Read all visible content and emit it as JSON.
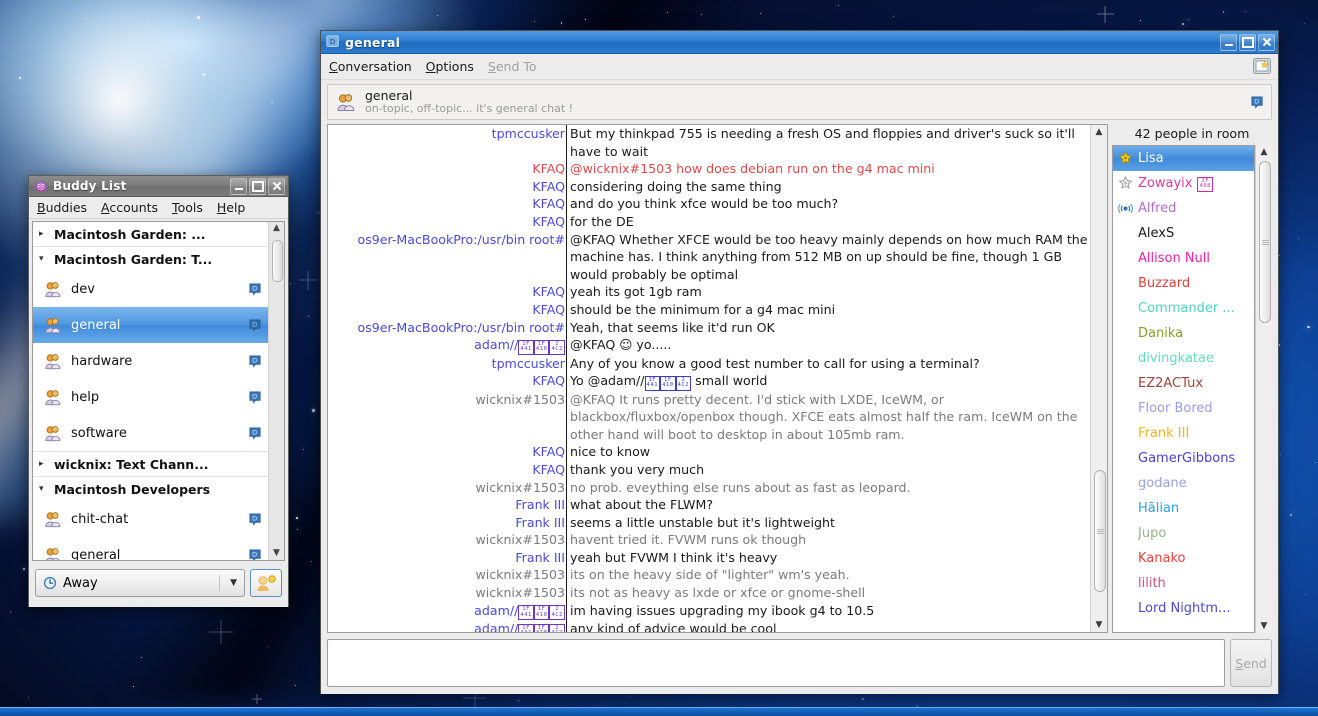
{
  "desktop": {
    "wallpaper": "space-nebula-blue"
  },
  "buddy_window": {
    "title": "Buddy List",
    "icon": "pidgin-buddy-icon",
    "menus": [
      {
        "label": "Buddies",
        "accel": "B"
      },
      {
        "label": "Accounts",
        "accel": "A"
      },
      {
        "label": "Tools",
        "accel": "T"
      },
      {
        "label": "Help",
        "accel": "H"
      }
    ],
    "window_buttons": [
      "minimize",
      "maximize",
      "close"
    ],
    "rows": [
      {
        "type": "group",
        "label": "Macintosh Garden: ...",
        "expanded": false
      },
      {
        "type": "group",
        "label": "Macintosh Garden: T...",
        "expanded": true
      },
      {
        "type": "chat",
        "label": "dev",
        "protocol_badge": "D",
        "selected": false
      },
      {
        "type": "chat",
        "label": "general",
        "protocol_badge": "D",
        "selected": true
      },
      {
        "type": "chat",
        "label": "hardware",
        "protocol_badge": "D",
        "selected": false
      },
      {
        "type": "chat",
        "label": "help",
        "protocol_badge": "D",
        "selected": false
      },
      {
        "type": "chat",
        "label": "software",
        "protocol_badge": "D",
        "selected": false
      },
      {
        "type": "group",
        "label": "wicknix: Text Chann...",
        "expanded": false
      },
      {
        "type": "group",
        "label": "Macintosh Developers",
        "expanded": true
      },
      {
        "type": "chat",
        "label": "chit-chat",
        "protocol_badge": "D",
        "selected": false
      },
      {
        "type": "chat",
        "label": "general",
        "protocol_badge": "D",
        "selected": false
      }
    ],
    "status": {
      "label": "Away",
      "icon": "away-clock-icon",
      "dropdown": "chevron-down-icon"
    },
    "account_button": "accounts-icon"
  },
  "conversation_window": {
    "title": "general",
    "icon": "protocol-d-icon",
    "window_buttons": [
      "minimize",
      "maximize",
      "close"
    ],
    "menus": [
      {
        "label": "Conversation",
        "accel": "C",
        "disabled": false
      },
      {
        "label": "Options",
        "accel": "O",
        "disabled": false
      },
      {
        "label": "Send To",
        "accel": "S",
        "disabled": true
      }
    ],
    "menu_right_icon": "conversation-notify-icon",
    "topic": {
      "icon": "chat-group-icon",
      "name": "general",
      "text": "on-topic, off-topic... it's general chat !",
      "badge": "D"
    },
    "user_count_label": "42 people in room",
    "entry": {
      "value": "",
      "placeholder": ""
    },
    "send_button": {
      "label": "Send",
      "accel": "S",
      "enabled": false
    },
    "messages": [
      {
        "who": "tpmccusker",
        "who_color": "#4a4ad6",
        "text": "But my thinkpad 755 is needing a fresh OS and floppies and driver's suck so it'll have to wait",
        "color": "#1a1a1a"
      },
      {
        "who": "KFAQ",
        "who_color": "#e04a4a",
        "text": "@wicknix#1503 how does debian run on the g4 mac mini",
        "color": "#e04a4a"
      },
      {
        "who": "KFAQ",
        "who_color": "#4a4ad6",
        "text": "considering doing the same thing",
        "color": "#1a1a1a"
      },
      {
        "who": "KFAQ",
        "who_color": "#4a4ad6",
        "text": "and do you think xfce would be too much?",
        "color": "#1a1a1a"
      },
      {
        "who": "KFAQ",
        "who_color": "#4a4ad6",
        "text": "for the DE",
        "color": "#1a1a1a"
      },
      {
        "who": "os9er-MacBookPro:/usr/bin root#",
        "who_color": "#4a4ad6",
        "text": "@KFAQ Whether XFCE would be too heavy mainly depends on how much RAM the machine has. I think anything from 512 MB on up should be fine, though 1 GB would probably be optimal",
        "color": "#1a1a1a"
      },
      {
        "who": "KFAQ",
        "who_color": "#4a4ad6",
        "text": "yeah its got 1gb ram",
        "color": "#1a1a1a"
      },
      {
        "who": "KFAQ",
        "who_color": "#4a4ad6",
        "text": "should be the minimum for a g4 mac mini",
        "color": "#1a1a1a"
      },
      {
        "who": "os9er-MacBookPro:/usr/bin root#",
        "who_color": "#4a4ad6",
        "text": "Yeah, that seems like it'd run OK",
        "color": "#1a1a1a"
      },
      {
        "who": "adam//",
        "who_color": "#4a4ad6",
        "who_tofu": [
          "1F441",
          "1F410",
          "24C2"
        ],
        "text": "@KFAQ ☺ yo.....",
        "color": "#1a1a1a"
      },
      {
        "who": "tpmccusker",
        "who_color": "#4a4ad6",
        "text": "Any of you know a good test number to call for using a terminal?",
        "color": "#1a1a1a"
      },
      {
        "who": "KFAQ",
        "who_color": "#4a4ad6",
        "text": "Yo @adam//",
        "text_tofu": [
          "1F441",
          "1F410",
          "24C2"
        ],
        "text_after": " small world",
        "color": "#1a1a1a"
      },
      {
        "who": "wicknix#1503",
        "who_color": "#7a7a7a",
        "text": "@KFAQ It runs pretty decent. I'd stick with LXDE, IceWM, or blackbox/fluxbox/openbox though. XFCE eats almost half the ram. IceWM on the other hand will boot to desktop in about 105mb ram.",
        "color": "#7a7a7a"
      },
      {
        "who": "KFAQ",
        "who_color": "#4a4ad6",
        "text": "nice to know",
        "color": "#1a1a1a"
      },
      {
        "who": "KFAQ",
        "who_color": "#4a4ad6",
        "text": "thank you very much",
        "color": "#1a1a1a"
      },
      {
        "who": "wicknix#1503",
        "who_color": "#7a7a7a",
        "text": "no prob. eveything else runs about as fast as leopard.",
        "color": "#7a7a7a"
      },
      {
        "who": "Frank III",
        "who_color": "#4a4ad6",
        "text": "what about the FLWM?",
        "color": "#1a1a1a"
      },
      {
        "who": "Frank III",
        "who_color": "#4a4ad6",
        "text": "seems a little unstable but it's lightweight",
        "color": "#1a1a1a"
      },
      {
        "who": "wicknix#1503",
        "who_color": "#7a7a7a",
        "text": "havent tried it. FVWM runs ok though",
        "color": "#7a7a7a"
      },
      {
        "who": "Frank III",
        "who_color": "#4a4ad6",
        "text": "yeah but FVWM I think it's heavy",
        "color": "#1a1a1a"
      },
      {
        "who": "wicknix#1503",
        "who_color": "#7a7a7a",
        "text": "its on the heavy side of \"lighter\" wm's yeah.",
        "color": "#7a7a7a"
      },
      {
        "who": "wicknix#1503",
        "who_color": "#7a7a7a",
        "text": "its not as heavy as lxde or xfce or gnome-shell",
        "color": "#7a7a7a"
      },
      {
        "who": "adam//",
        "who_color": "#4a4ad6",
        "who_tofu": [
          "1F441",
          "1F410",
          "24C2"
        ],
        "text": "im having issues upgrading my ibook g4 to 10.5",
        "color": "#1a1a1a"
      },
      {
        "who": "adam//",
        "who_color": "#4a4ad6",
        "who_tofu": [
          "1F441",
          "1F410",
          "24C2"
        ],
        "text": "any kind of advice would be cool",
        "color": "#1a1a1a"
      }
    ],
    "users": [
      {
        "name": "Lisa",
        "color": "#ffffff",
        "icon": "gold-star-icon",
        "selected": true
      },
      {
        "name": "Zowayix",
        "color": "#e0389e",
        "icon": "gray-star-icon",
        "tofu": [
          "1F408"
        ],
        "selected": false
      },
      {
        "name": "Alfred",
        "color": "#b06bd6",
        "icon": "voice-icon",
        "selected": false
      },
      {
        "name": "AlexS",
        "color": "#1a1a1a",
        "icon": "",
        "selected": false
      },
      {
        "name": "Allison Null",
        "color": "#f21fa8",
        "icon": "",
        "selected": false
      },
      {
        "name": "Buzzard",
        "color": "#e8413c",
        "icon": "",
        "selected": false
      },
      {
        "name": "Commander ...",
        "color": "#4fd4c0",
        "icon": "",
        "selected": false
      },
      {
        "name": "Danika",
        "color": "#8b9c2a",
        "icon": "",
        "selected": false
      },
      {
        "name": "divingkatae",
        "color": "#5fe0c0",
        "icon": "",
        "selected": false
      },
      {
        "name": "EZ2ACTux",
        "color": "#a0423c",
        "icon": "",
        "selected": false
      },
      {
        "name": "Floor Bored",
        "color": "#9a9ce8",
        "icon": "",
        "selected": false
      },
      {
        "name": "Frank III",
        "color": "#f0b41c",
        "icon": "",
        "selected": false
      },
      {
        "name": "GamerGibbons",
        "color": "#4a3fd0",
        "icon": "",
        "selected": false
      },
      {
        "name": "godane",
        "color": "#9aa0e0",
        "icon": "",
        "selected": false
      },
      {
        "name": "Hālian",
        "color": "#2aa3e0",
        "icon": "",
        "selected": false
      },
      {
        "name": "Jupo",
        "color": "#9ab088",
        "icon": "",
        "selected": false
      },
      {
        "name": "Kanako",
        "color": "#f0413c",
        "icon": "",
        "selected": false
      },
      {
        "name": "lilith",
        "color": "#d0527a",
        "icon": "",
        "selected": false
      },
      {
        "name": "Lord Nightm...",
        "color": "#4a4ad6",
        "icon": "",
        "selected": false
      }
    ]
  }
}
